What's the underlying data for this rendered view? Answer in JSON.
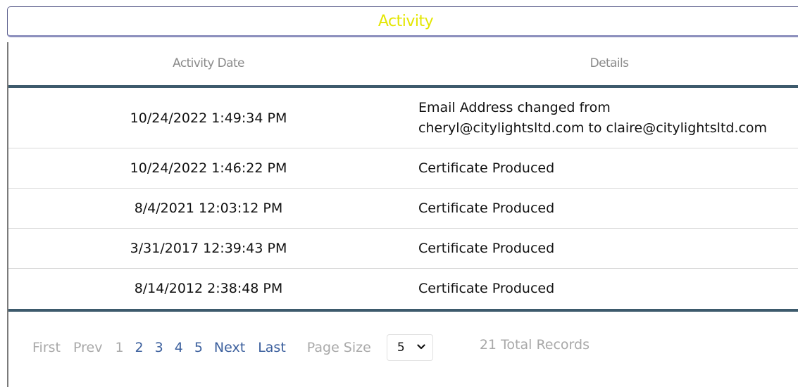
{
  "panel": {
    "title": "Activity"
  },
  "columns": {
    "date": "Activity Date",
    "details": "Details"
  },
  "rows": [
    {
      "date": "10/24/2022 1:49:34 PM",
      "details": [
        "Email Address changed from",
        "cheryl@citylightsltd.com to claire@citylightsltd.com"
      ]
    },
    {
      "date": "10/24/2022 1:46:22 PM",
      "details": [
        "Certificate Produced"
      ]
    },
    {
      "date": "8/4/2021 12:03:12 PM",
      "details": [
        "Certificate Produced"
      ]
    },
    {
      "date": "3/31/2017 12:39:43 PM",
      "details": [
        "Certificate Produced"
      ]
    },
    {
      "date": "8/14/2012 2:38:48 PM",
      "details": [
        "Certificate Produced"
      ]
    }
  ],
  "pager": {
    "first": "First",
    "prev": "Prev",
    "pages": [
      "1",
      "2",
      "3",
      "4",
      "5"
    ],
    "current_page": "1",
    "next": "Next",
    "last": "Last",
    "page_size_label": "Page Size",
    "page_size_value": "5",
    "total_records": "21 Total Records"
  },
  "colors": {
    "title": "#e3e600",
    "link": "#3b5f9d",
    "rule": "#3d5a6c",
    "muted": "#a9a9a9"
  },
  "icons": {
    "dropdown": "chevron-down-icon"
  }
}
